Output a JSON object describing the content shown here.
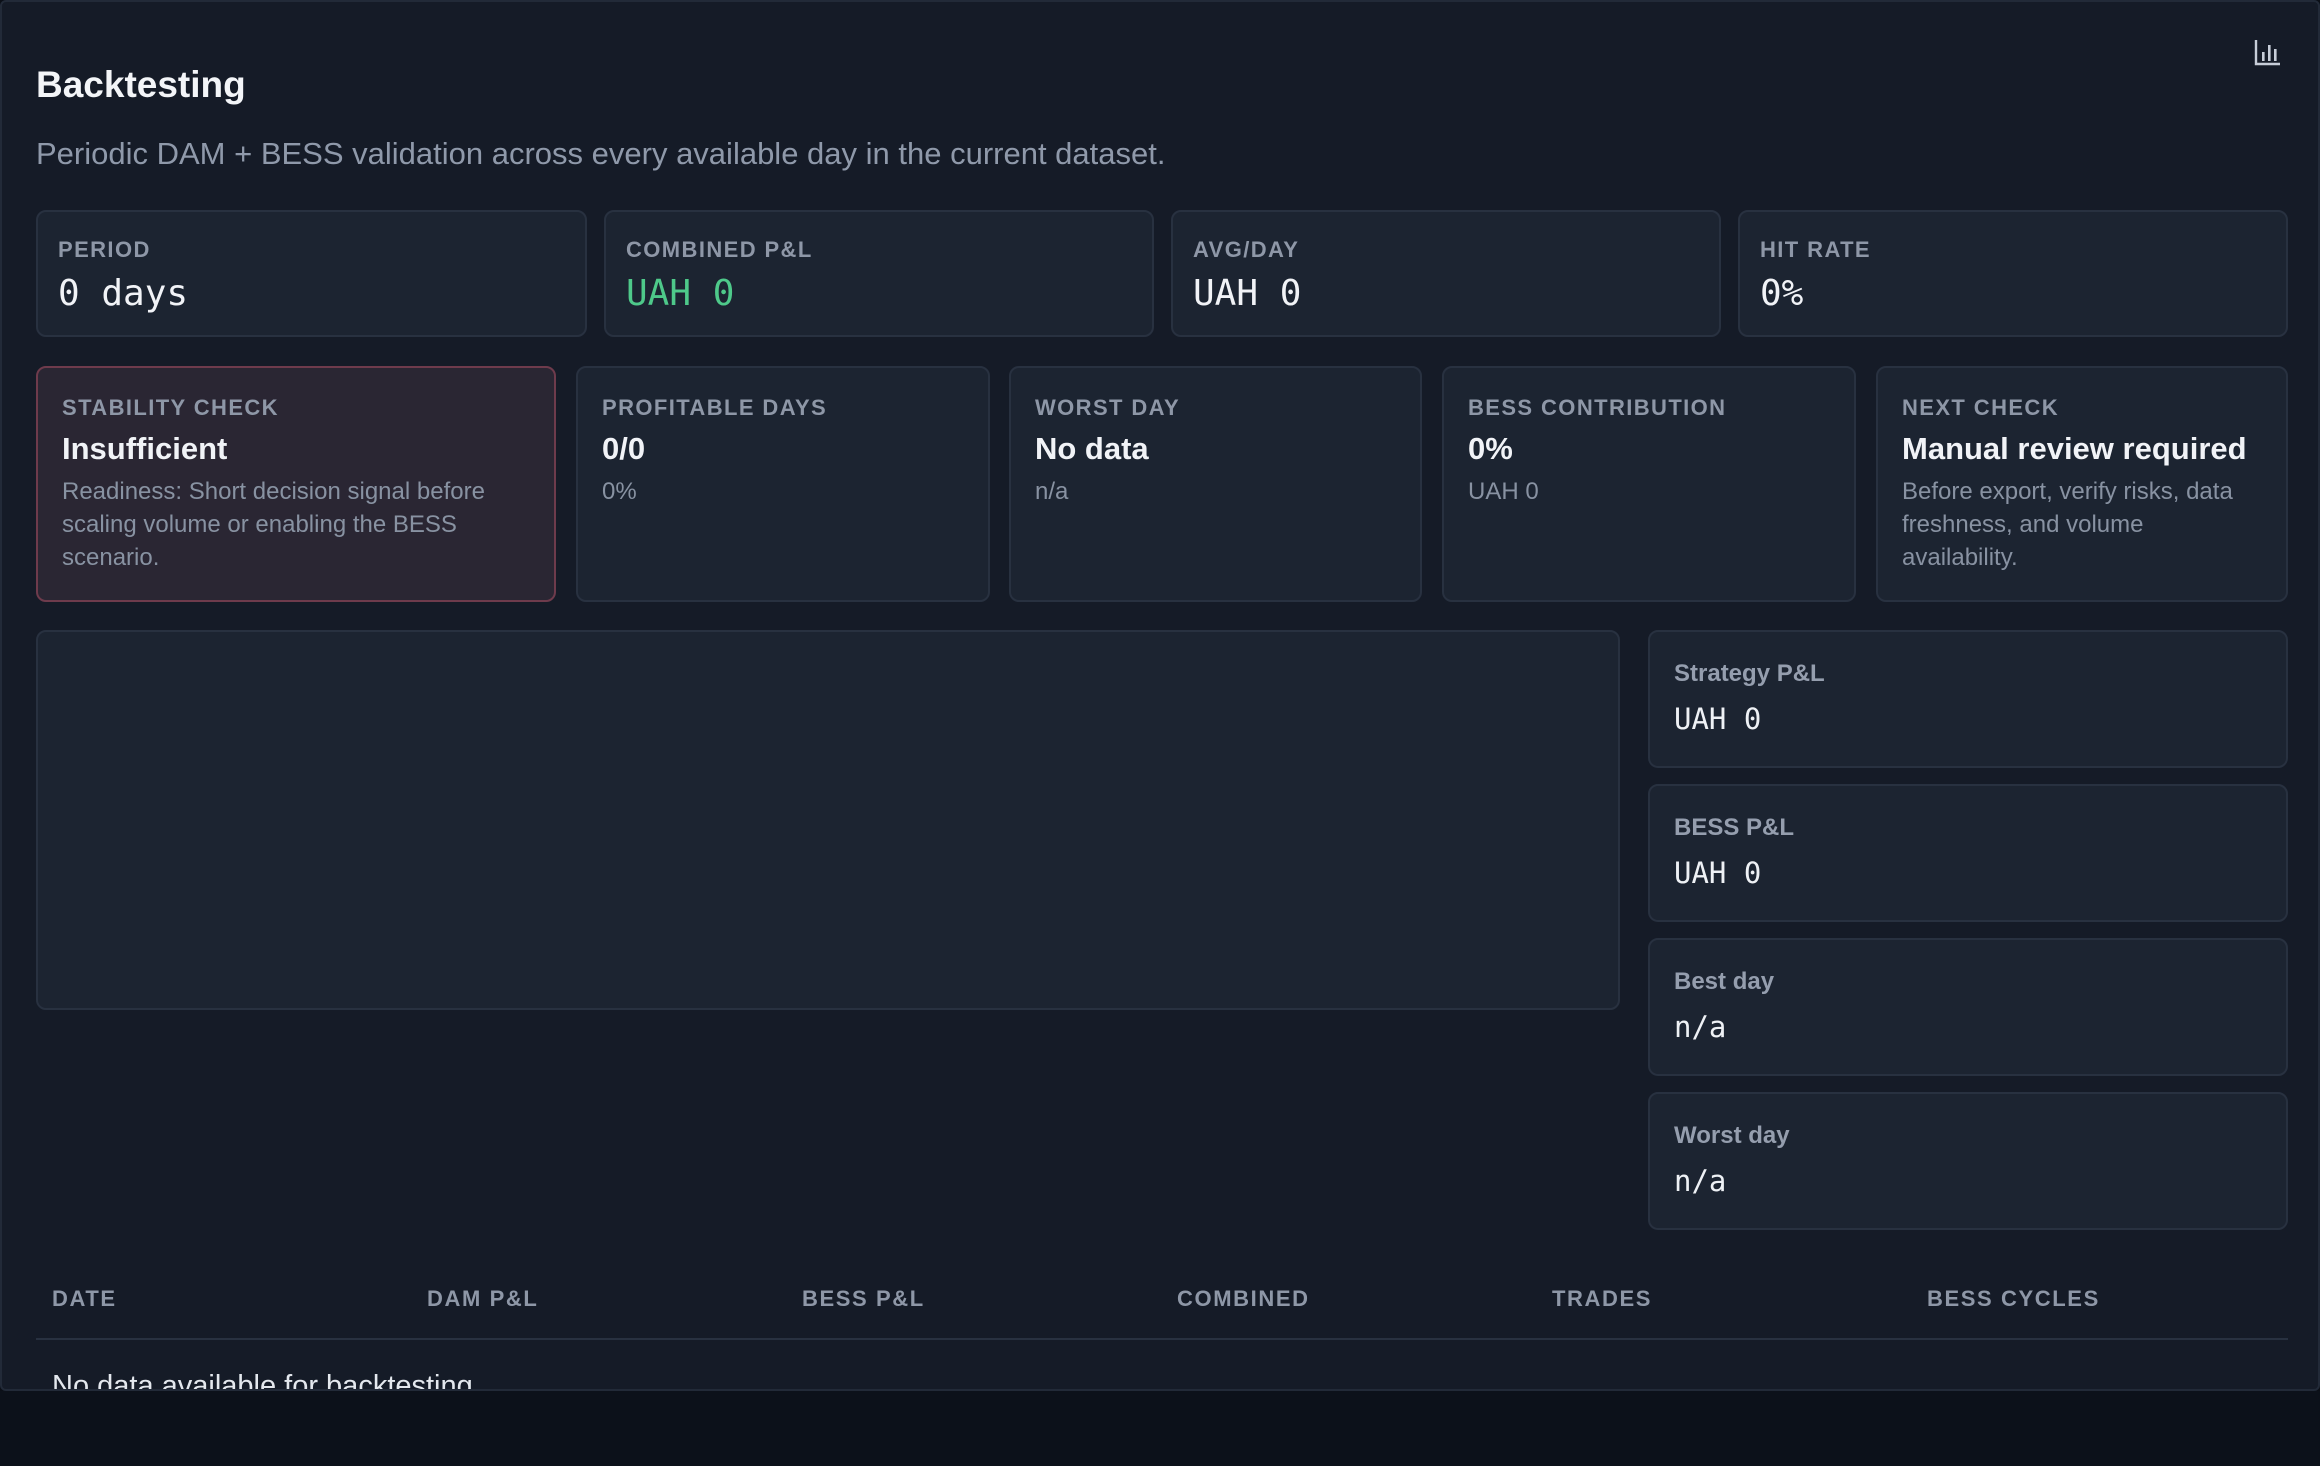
{
  "header": {
    "title": "Backtesting",
    "subtitle": "Periodic DAM + BESS validation across every available day in the current dataset."
  },
  "kpis": [
    {
      "label": "PERIOD",
      "value": "0 days"
    },
    {
      "label": "COMBINED P&L",
      "value": "UAH 0"
    },
    {
      "label": "AVG/DAY",
      "value": "UAH 0"
    },
    {
      "label": "HIT RATE",
      "value": "0%"
    }
  ],
  "sections": [
    {
      "label": "STABILITY CHECK",
      "value": "Insufficient",
      "note": "Readiness: Short decision signal before scaling volume or enabling the BESS scenario."
    },
    {
      "label": "PROFITABLE DAYS",
      "value": "0/0",
      "note": "0%"
    },
    {
      "label": "WORST DAY",
      "value": "No data",
      "note": "n/a"
    },
    {
      "label": "BESS CONTRIBUTION",
      "value": "0%",
      "note": "UAH 0"
    },
    {
      "label": "NEXT CHECK",
      "value": "Manual review required",
      "note": "Before export, verify risks, data freshness, and volume availability."
    }
  ],
  "side": [
    {
      "label": "Strategy P&L",
      "value": "UAH 0"
    },
    {
      "label": "BESS P&L",
      "value": "UAH 0"
    },
    {
      "label": "Best day",
      "value": "n/a"
    },
    {
      "label": "Worst day",
      "value": "n/a"
    }
  ],
  "table": {
    "columns": [
      "DATE",
      "DAM P&L",
      "BESS P&L",
      "COMBINED",
      "TRADES",
      "BESS CYCLES"
    ],
    "empty_message": "No data available for backtesting."
  },
  "colors": {
    "positive": "#4ec98a",
    "alert_border": "#6e3b4c"
  },
  "icons": {
    "chart_toggle": "bar-chart-icon"
  }
}
